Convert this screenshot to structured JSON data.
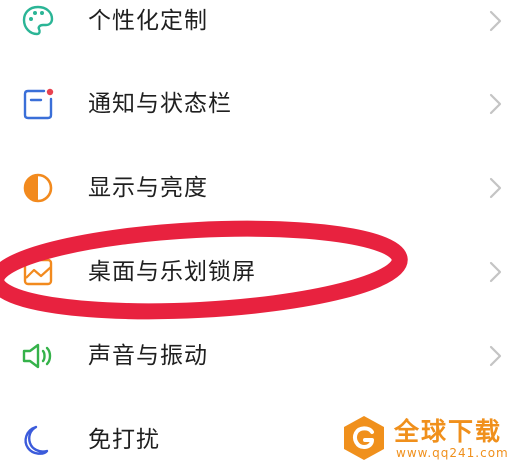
{
  "settings": {
    "items": [
      {
        "label": "个性化定制",
        "icon": "palette-icon"
      },
      {
        "label": "通知与状态栏",
        "icon": "notification-icon"
      },
      {
        "label": "显示与亮度",
        "icon": "brightness-icon"
      },
      {
        "label": "桌面与乐划锁屏",
        "icon": "wallpaper-icon"
      },
      {
        "label": "声音与振动",
        "icon": "speaker-icon"
      },
      {
        "label": "免打扰",
        "icon": "moon-icon"
      }
    ]
  },
  "colors": {
    "palette_teal": "#2bb596",
    "notification_blue": "#3a6fd8",
    "notification_dot": "#e8424f",
    "brightness_orange": "#f28a1e",
    "speaker_green": "#35b24a",
    "moon_blue": "#3b5bdb",
    "chevron_gray": "#c4c4c4",
    "annotation_red": "#e8223f",
    "watermark_orange": "#f0901c"
  },
  "watermark": {
    "brand": "全球下载",
    "url": "www.qq241.com"
  }
}
